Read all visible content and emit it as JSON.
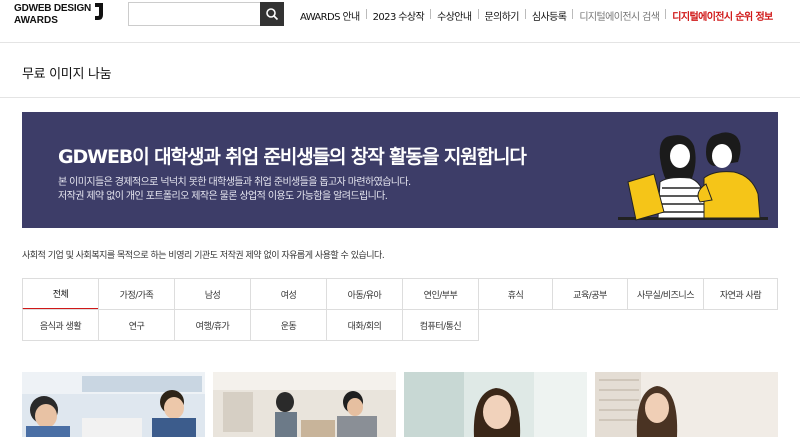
{
  "header": {
    "logo_line1": "GDWEB DESIGN",
    "logo_line2": "AWARDS",
    "search": {
      "value": "",
      "placeholder": ""
    },
    "nav": [
      {
        "label": "AWARDS 안내"
      },
      {
        "label": "2023 수상작"
      },
      {
        "label": "수상안내"
      },
      {
        "label": "문의하기"
      },
      {
        "label": "심사등록"
      },
      {
        "label": "디지털에이전시 검색"
      },
      {
        "label": "디지털에이전시 순위 정보"
      }
    ]
  },
  "page_title": "무료 이미지 나눔",
  "banner": {
    "title": "GDWEB이 대학생과 취업 준비생들의 창작 활동을 지원합니다",
    "desc_line1": "본 이미지들은 경제적으로 넉넉치 못한 대학생들과 취업 준비생들을 돕고자 마련하였습니다.",
    "desc_line2": "저작권 제약 없이 개인 포트폴리오 제작은 물론 상업적 이용도 가능함을 알려드립니다.",
    "bg_color": "#3d3d68"
  },
  "note": "사회적 기업 및 사회복지를 목적으로 하는 비영리 기관도 저작권 제약 없이 자유롭게 사용할 수 있습니다.",
  "categories": [
    {
      "label": "전체",
      "active": true
    },
    {
      "label": "가정/가족"
    },
    {
      "label": "남성"
    },
    {
      "label": "여성"
    },
    {
      "label": "아동/유아"
    },
    {
      "label": "연인/부부"
    },
    {
      "label": "휴식"
    },
    {
      "label": "교육/공부"
    },
    {
      "label": "사무실/비즈니스"
    },
    {
      "label": "자연과 사람"
    },
    {
      "label": "음식과 생활"
    },
    {
      "label": "연구"
    },
    {
      "label": "여행/휴가"
    },
    {
      "label": "운동"
    },
    {
      "label": "대화/회의"
    },
    {
      "label": "컴퓨터/통신"
    }
  ],
  "colors": {
    "accent_red": "#d01818",
    "search_button": "#333333"
  },
  "icons": {
    "search": "search-icon"
  }
}
